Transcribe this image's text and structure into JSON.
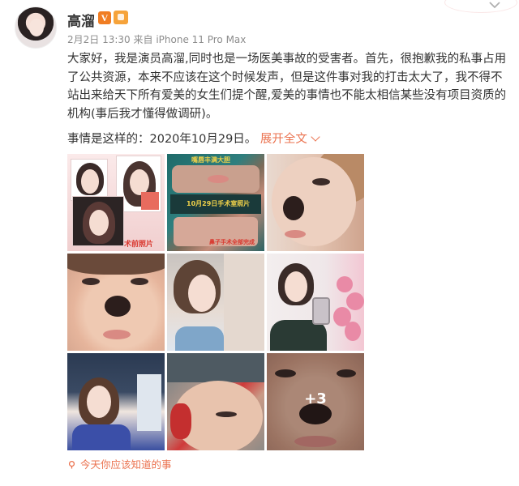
{
  "author": {
    "name": "高溜",
    "verified_badge": "V",
    "icons": [
      "avatar",
      "verified-icon",
      "vip-level-icon"
    ]
  },
  "meta": {
    "date": "2月2日 13:30",
    "source": "来自 iPhone 11 Pro Max"
  },
  "post": {
    "text": "大家好，我是演员高溜,同时也是一场医美事故的受害者。首先，很抱歉我的私事占用了公共资源，本来不应该在这个时候发声，但是这件事对我的打击太大了，我不得不站出来给天下所有爱美的女生们提个醒,爱美的事情也不能太相信某些没有项目资质的机构(事后我才懂得做调研)。",
    "date_line": "事情是这样的：2020年10月29日。",
    "expand_label": "展开全文"
  },
  "images": {
    "c1_caption": "术前照片",
    "c2_caption_top": "嘴唇丰满大胆",
    "c2_caption_mid": "10月29日手术室照片",
    "c2_caption_bottom": "鼻子手术全部完成",
    "more_count": "+3"
  },
  "footer": {
    "topic": "今天你应该知道的事"
  },
  "colors": {
    "accent": "#eb7350",
    "meta": "#8c8c8c",
    "verified": "#f07d23"
  }
}
